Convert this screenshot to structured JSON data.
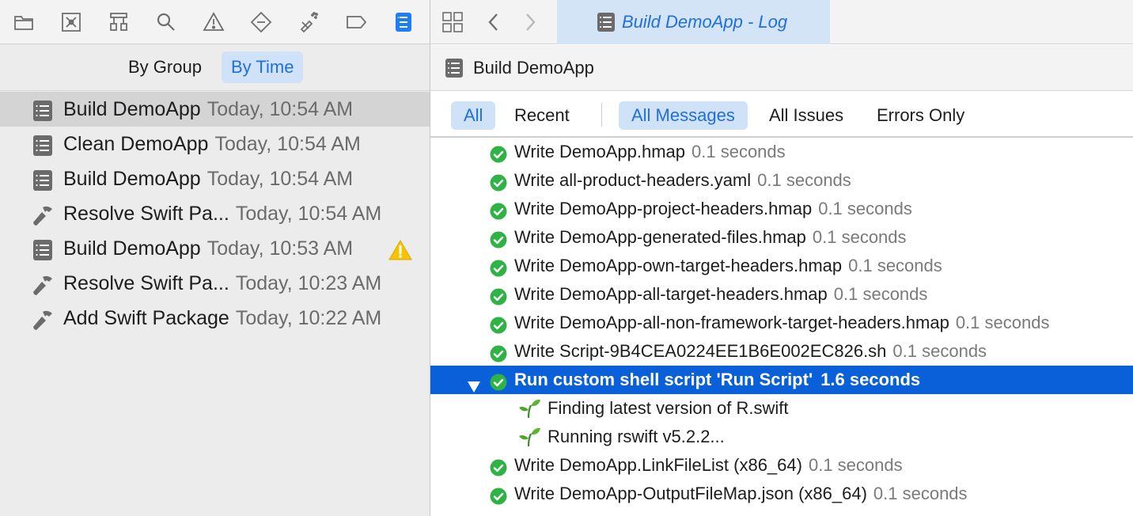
{
  "navigator": {
    "icons": [
      "folder-icon",
      "source-control-icon",
      "symbol-icon",
      "find-icon",
      "issue-icon",
      "test-icon",
      "debug-icon",
      "breakpoint-icon",
      "report-icon"
    ],
    "segments": {
      "by_group": "By Group",
      "by_time": "By Time"
    },
    "logs": [
      {
        "title": "Build DemoApp",
        "time": "Today, 10:54 AM",
        "icon": "log-icon",
        "warning": false,
        "selected": true
      },
      {
        "title": "Clean DemoApp",
        "time": "Today, 10:54 AM",
        "icon": "log-icon",
        "warning": false,
        "selected": false
      },
      {
        "title": "Build DemoApp",
        "time": "Today, 10:54 AM",
        "icon": "log-icon",
        "warning": false,
        "selected": false
      },
      {
        "title": "Resolve Swift Pa...",
        "time": "Today, 10:54 AM",
        "icon": "hammer-icon",
        "warning": false,
        "selected": false
      },
      {
        "title": "Build DemoApp",
        "time": "Today, 10:53 AM",
        "icon": "log-icon",
        "warning": true,
        "selected": false
      },
      {
        "title": "Resolve Swift Pa...",
        "time": "Today, 10:23 AM",
        "icon": "hammer-icon",
        "warning": false,
        "selected": false
      },
      {
        "title": "Add Swift Package",
        "time": "Today, 10:22 AM",
        "icon": "hammer-icon",
        "warning": false,
        "selected": false
      }
    ]
  },
  "editor": {
    "tab_title": "Build DemoApp - Log",
    "jump_bar_title": "Build DemoApp",
    "filters": {
      "all": "All",
      "recent": "Recent",
      "all_messages": "All Messages",
      "all_issues": "All Issues",
      "errors_only": "Errors Only"
    },
    "messages": [
      {
        "text": "Write DemoApp.hmap",
        "duration": "0.1 seconds"
      },
      {
        "text": "Write all-product-headers.yaml",
        "duration": "0.1 seconds"
      },
      {
        "text": "Write DemoApp-project-headers.hmap",
        "duration": "0.1 seconds"
      },
      {
        "text": "Write DemoApp-generated-files.hmap",
        "duration": "0.1 seconds"
      },
      {
        "text": "Write DemoApp-own-target-headers.hmap",
        "duration": "0.1 seconds"
      },
      {
        "text": "Write DemoApp-all-target-headers.hmap",
        "duration": "0.1 seconds"
      },
      {
        "text": "Write DemoApp-all-non-framework-target-headers.hmap",
        "duration": "0.1 seconds"
      },
      {
        "text": "Write Script-9B4CEA0224EE1B6E002EC826.sh",
        "duration": "0.1 seconds"
      },
      {
        "text": "Run custom shell script 'Run Script'",
        "duration": "1.6 seconds"
      },
      {
        "text": "Finding latest version of R.swift"
      },
      {
        "text": "Running rswift v5.2.2..."
      },
      {
        "text": "Write DemoApp.LinkFileList (x86_64)",
        "duration": "0.1 seconds"
      },
      {
        "text": "Write DemoApp-OutputFileMap.json (x86_64)",
        "duration": "0.1 seconds"
      }
    ]
  },
  "colors": {
    "accent": "#1f6fe0",
    "selection": "#0a60d8",
    "success": "#2fb344",
    "warning": "#f5c400"
  }
}
